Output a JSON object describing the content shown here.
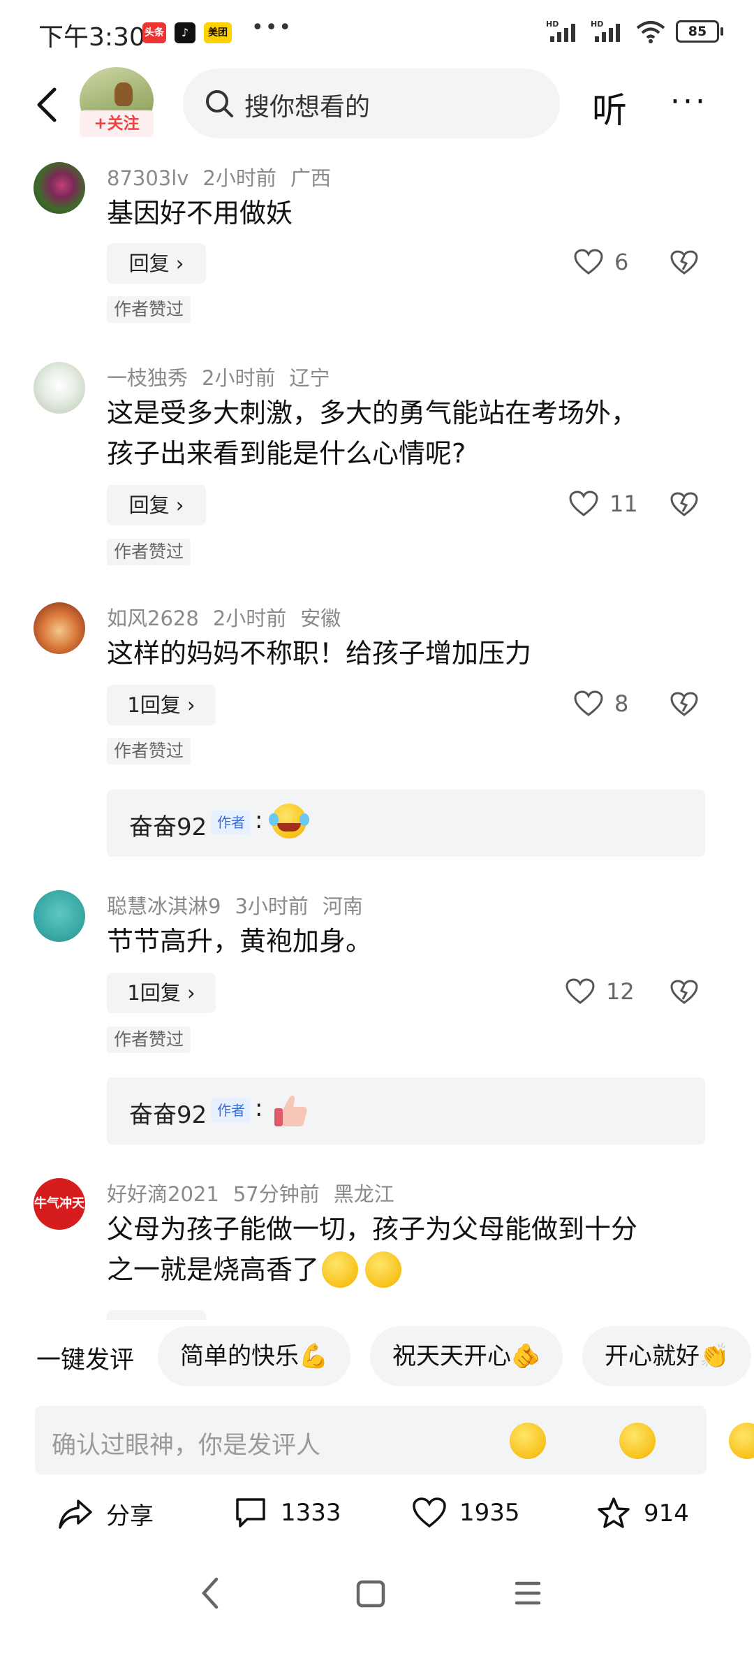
{
  "status_bar": {
    "time": "下午3:30",
    "apps": [
      "头条",
      "♪",
      "美团"
    ],
    "dots": "•••",
    "network": [
      "HD",
      "HD"
    ],
    "battery": "85"
  },
  "header": {
    "follow_label": "+关注",
    "search_placeholder": "搜你想看的",
    "listen_label": "听",
    "more_label": "···"
  },
  "comments": [
    {
      "user": "87303lv",
      "time": "2小时前",
      "region": "广西",
      "lines": [
        "基因好不用做妖"
      ],
      "reply": "回复 ›",
      "likes": "6",
      "author_liked": "作者赞过"
    },
    {
      "user": "一枝独秀",
      "time": "2小时前",
      "region": "辽宁",
      "lines": [
        "这是受多大刺激，多大的勇气能站在考场外，",
        "孩子出来看到能是什么心情呢?"
      ],
      "reply": "回复 ›",
      "likes": "11",
      "author_liked": "作者赞过"
    },
    {
      "user": "如风2628",
      "time": "2小时前",
      "region": "安徽",
      "lines": [
        "这样的妈妈不称职！给孩子增加压力"
      ],
      "reply": "1回复 ›",
      "likes": "8",
      "author_liked": "作者赞过",
      "sub": {
        "author": "奋奋92",
        "badge": "作者",
        "colon": ":"
      }
    },
    {
      "user": "聪慧冰淇淋9",
      "time": "3小时前",
      "region": "河南",
      "lines": [
        "节节高升，黄袍加身。"
      ],
      "reply": "1回复 ›",
      "likes": "12",
      "author_liked": "作者赞过",
      "sub": {
        "author": "奋奋92",
        "badge": "作者",
        "colon": ":"
      }
    },
    {
      "user": "好好滴2021",
      "time": "57分钟前",
      "region": "黑龙江",
      "lines": [
        "父母为孩子能做一切，孩子为父母能做到十分",
        "之一就是烧高香了"
      ],
      "avatar_text": "牛气冲天"
    }
  ],
  "quick_reply": {
    "label": "一键发评",
    "chips": [
      "简单的快乐💪",
      "祝天天开心🫵",
      "开心就好👏"
    ]
  },
  "input": {
    "placeholder": "确认过眼神，你是发评人"
  },
  "actions": {
    "share": "分享",
    "comments": "1333",
    "likes": "1935",
    "favorites": "914"
  }
}
